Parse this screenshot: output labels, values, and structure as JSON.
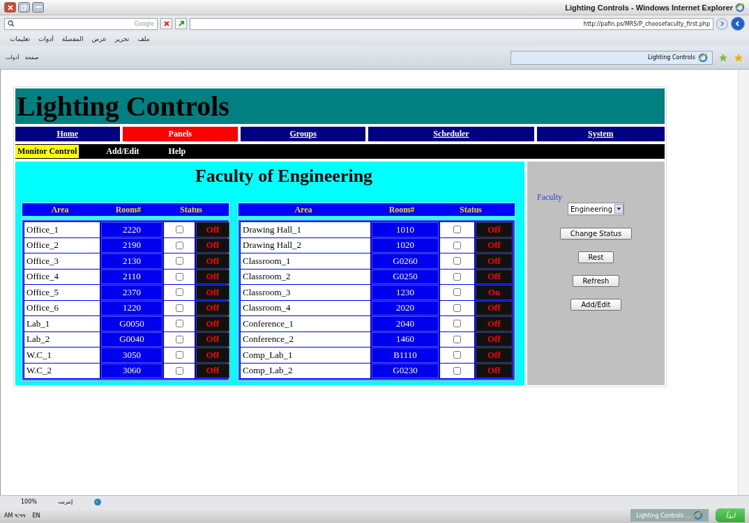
{
  "window": {
    "title": "Lighting Controls - Windows Internet Explorer"
  },
  "search_bar": {
    "placeholder": "Google"
  },
  "address_bar": {
    "value": "http://pafin.ps/MRS/P_choosefaculty_first.php"
  },
  "menu_bar": [
    "ملف",
    "تحرير",
    "عرض",
    "المفضلة",
    "أدوات",
    "تعليمات"
  ],
  "command_bar": [
    {
      "label": "صفحة"
    },
    {
      "label": "أدوات"
    }
  ],
  "browser_tab": {
    "label": "Lighting Controls"
  },
  "page": {
    "title": "Lighting Controls",
    "nav": [
      {
        "label": "Home",
        "selected": false
      },
      {
        "label": "Panels",
        "selected": true
      },
      {
        "label": "Groups",
        "selected": false
      },
      {
        "label": "Scheduler",
        "selected": false
      },
      {
        "label": "System",
        "selected": false
      }
    ],
    "subnav": [
      {
        "label": "Monitor Control",
        "selected": true
      },
      {
        "label": "Add/Edit",
        "selected": false
      },
      {
        "label": "Help",
        "selected": false
      }
    ],
    "heading": "Faculty of Engineering",
    "tables": [
      {
        "columns": [
          "Area",
          "Room#",
          "Status"
        ],
        "rows": [
          {
            "area": "Office_1",
            "room": "2220",
            "checked": false,
            "status": "Off"
          },
          {
            "area": "Office_2",
            "room": "2190",
            "checked": false,
            "status": "Off"
          },
          {
            "area": "Office_3",
            "room": "2130",
            "checked": false,
            "status": "Off"
          },
          {
            "area": "Office_4",
            "room": "2110",
            "checked": false,
            "status": "Off"
          },
          {
            "area": "Office_5",
            "room": "2370",
            "checked": false,
            "status": "Off"
          },
          {
            "area": "Office_6",
            "room": "1220",
            "checked": false,
            "status": "Off"
          },
          {
            "area": "Lab_1",
            "room": "G0050",
            "checked": false,
            "status": "Off"
          },
          {
            "area": "Lab_2",
            "room": "G0040",
            "checked": false,
            "status": "Off"
          },
          {
            "area": "W.C_1",
            "room": "3050",
            "checked": false,
            "status": "Off"
          },
          {
            "area": "W.C_2",
            "room": "3060",
            "checked": false,
            "status": "Off"
          }
        ]
      },
      {
        "columns": [
          "Area",
          "Room#",
          "Status"
        ],
        "rows": [
          {
            "area": "Drawing Hall_1",
            "room": "1010",
            "checked": false,
            "status": "Off"
          },
          {
            "area": "Drawing Hall_2",
            "room": "1020",
            "checked": false,
            "status": "Off"
          },
          {
            "area": "Classroom_1",
            "room": "G0260",
            "checked": false,
            "status": "Off"
          },
          {
            "area": "Classroom_2",
            "room": "G0250",
            "checked": false,
            "status": "Off"
          },
          {
            "area": "Classroom_3",
            "room": "1230",
            "checked": false,
            "status": "On"
          },
          {
            "area": "Classroom_4",
            "room": "2020",
            "checked": false,
            "status": "Off"
          },
          {
            "area": "Conference_1",
            "room": "2040",
            "checked": false,
            "status": "Off"
          },
          {
            "area": "Conference_2",
            "room": "1460",
            "checked": false,
            "status": "Off"
          },
          {
            "area": "Comp_Lab_1",
            "room": "B1110",
            "checked": false,
            "status": "Off"
          },
          {
            "area": "Comp_Lab_2",
            "room": "G0230",
            "checked": false,
            "status": "Off"
          }
        ]
      }
    ],
    "side_panel": {
      "label": "Faculty",
      "select": "Engineering",
      "buttons": [
        "Change Status",
        "Rest",
        "Refresh",
        "Add/Edit"
      ]
    }
  },
  "status_bar": {
    "zone": "إنترنت",
    "zoom": "100%"
  },
  "taskbar": {
    "clock": "AM ٩:٩٩",
    "language": "EN",
    "task": "Lighting Controls ...",
    "start": "ابدأ"
  }
}
